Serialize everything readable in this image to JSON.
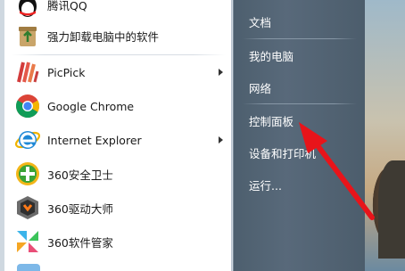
{
  "start_menu": {
    "programs": [
      {
        "label": "腾讯QQ",
        "icon": "qq-penguin-icon",
        "has_submenu": false
      },
      {
        "label": "强力卸载电脑中的软件",
        "icon": "recycle-uninstall-icon",
        "has_submenu": false
      },
      {
        "label": "PicPick",
        "icon": "picpick-icon",
        "has_submenu": true
      },
      {
        "label": "Google Chrome",
        "icon": "chrome-icon",
        "has_submenu": false
      },
      {
        "label": "Internet Explorer",
        "icon": "ie-icon",
        "has_submenu": true
      },
      {
        "label": "360安全卫士",
        "icon": "360-safe-icon",
        "has_submenu": false
      },
      {
        "label": "360驱动大师",
        "icon": "360-driver-icon",
        "has_submenu": false
      },
      {
        "label": "360软件管家",
        "icon": "360-software-icon",
        "has_submenu": false
      }
    ],
    "right_links": [
      {
        "label": "文档"
      },
      {
        "label": "我的电脑"
      },
      {
        "label": "网络"
      },
      {
        "label": "控制面板"
      },
      {
        "label": "设备和打印机"
      },
      {
        "label": "运行..."
      }
    ]
  },
  "colors": {
    "annotation_arrow": "#e8141a",
    "right_pane": "#56687a",
    "left_pane": "#ffffff"
  }
}
